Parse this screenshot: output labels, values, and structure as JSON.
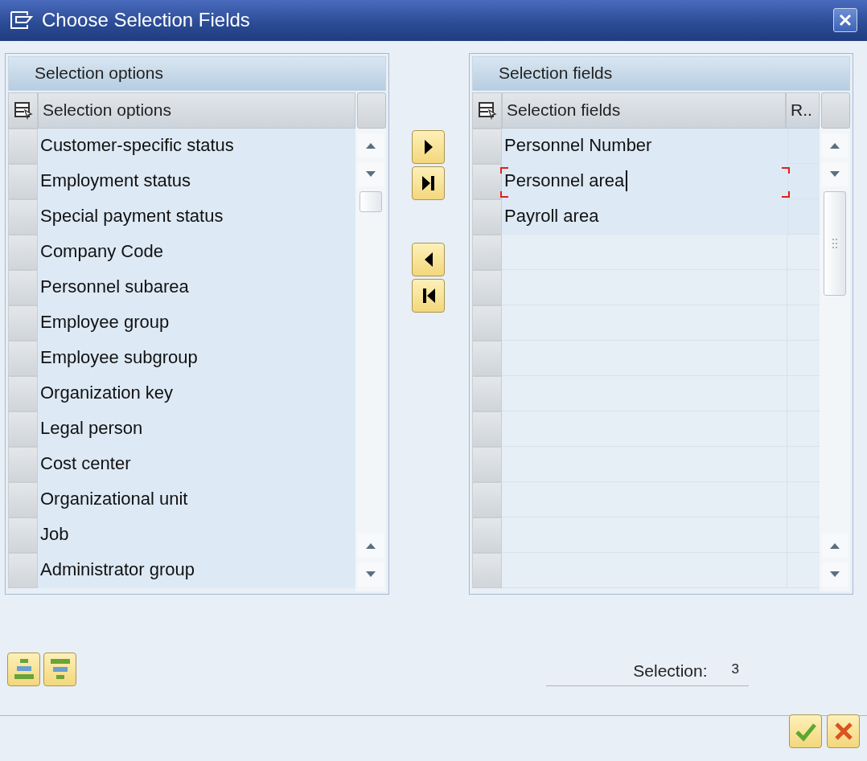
{
  "window": {
    "title": "Choose Selection Fields"
  },
  "left_panel": {
    "title": "Selection options",
    "column": "Selection options",
    "rows": [
      {
        "text": "Customer-specific status"
      },
      {
        "text": "Employment status"
      },
      {
        "text": "Special payment status"
      },
      {
        "text": "Company Code"
      },
      {
        "text": "Personnel subarea"
      },
      {
        "text": "Employee group"
      },
      {
        "text": "Employee subgroup"
      },
      {
        "text": "Organization key"
      },
      {
        "text": "Legal person"
      },
      {
        "text": "Cost center"
      },
      {
        "text": "Organizational unit"
      },
      {
        "text": "Job"
      },
      {
        "text": "Administrator group"
      }
    ]
  },
  "right_panel": {
    "title": "Selection fields",
    "columns": [
      "Selection fields",
      "R.."
    ],
    "rows": [
      {
        "text": "Personnel Number",
        "focused": false
      },
      {
        "text": "Personnel area",
        "focused": true
      },
      {
        "text": "Payroll area",
        "focused": false
      }
    ]
  },
  "selection": {
    "label": "Selection:",
    "count": "3"
  }
}
